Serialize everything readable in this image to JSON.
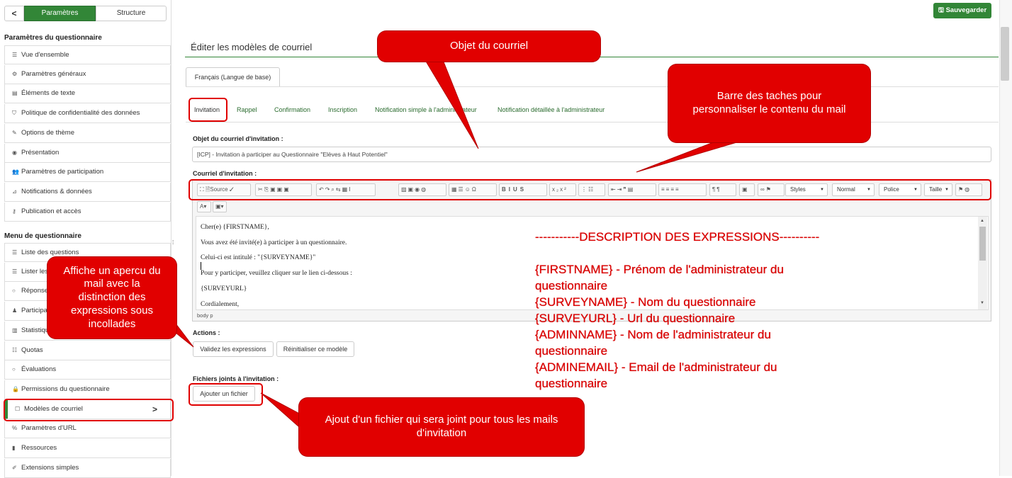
{
  "sidebar": {
    "back_icon": "chevron-left-icon",
    "back_label": "<",
    "tab_params": "Paramètres",
    "tab_structure": "Structure",
    "section1": "Paramètres du questionnaire",
    "section2": "Menu de questionnaire",
    "items1": [
      {
        "icon": "list-icon",
        "glyph": "☰",
        "label": "Vue d'ensemble"
      },
      {
        "icon": "gears-icon",
        "glyph": "⚙",
        "label": "Paramètres généraux"
      },
      {
        "icon": "file-text-icon",
        "glyph": "▤",
        "label": "Éléments de texte"
      },
      {
        "icon": "shield-icon",
        "glyph": "⛉",
        "label": "Politique de confidentialité des données"
      },
      {
        "icon": "brush-icon",
        "glyph": "✎",
        "label": "Options de thème"
      },
      {
        "icon": "eye-icon",
        "glyph": "◉",
        "label": "Présentation"
      },
      {
        "icon": "users-icon",
        "glyph": "👥",
        "label": "Paramètres de participation"
      },
      {
        "icon": "rss-icon",
        "glyph": "⊿",
        "label": "Notifications & données"
      },
      {
        "icon": "key-icon",
        "glyph": "⚷",
        "label": "Publication et accès"
      }
    ],
    "items2": [
      {
        "icon": "list-icon",
        "glyph": "☰",
        "label": "Liste des questions"
      },
      {
        "icon": "list-icon",
        "glyph": "☰",
        "label": "Lister les groupes de questions"
      },
      {
        "icon": "comment-icon",
        "glyph": "○",
        "label": "Réponses"
      },
      {
        "icon": "user-icon",
        "glyph": "♟",
        "label": "Participants"
      },
      {
        "icon": "bar-chart-icon",
        "glyph": "▥",
        "label": "Statistiques"
      },
      {
        "icon": "tasks-icon",
        "glyph": "☷",
        "label": "Quotas"
      },
      {
        "icon": "comment-icon",
        "glyph": "○",
        "label": "Évaluations"
      },
      {
        "icon": "lock-icon",
        "glyph": "🔒",
        "label": "Permissions du questionnaire"
      },
      {
        "icon": "envelope-icon",
        "glyph": "☐",
        "label": "Modèles de courriel"
      },
      {
        "icon": "link-icon",
        "glyph": "%",
        "label": "Paramètres d'URL"
      },
      {
        "icon": "file-icon",
        "glyph": "▮",
        "label": "Ressources"
      },
      {
        "icon": "plug-icon",
        "glyph": "✐",
        "label": "Extensions simples"
      }
    ],
    "active_chevron": ">"
  },
  "header": {
    "save_icon": "save-icon",
    "save_label": "Sauvegarder",
    "page_title": "Éditer les modèles de courriel",
    "language_tab": "Français (Langue de base)"
  },
  "mail_tabs": [
    "Invitation",
    "Rappel",
    "Confirmation",
    "Inscription",
    "Notification simple à l'administrateur",
    "Notification détaillée à l'administrateur"
  ],
  "form": {
    "subject_label": "Objet du courriel d'invitation :",
    "subject_value": "[ICP] - Invitation à participer au Questionnaire \"Elèves à Haut Potentiel\"",
    "body_label": "Courriel d'invitation :",
    "toolbar": {
      "source_label": "Source",
      "styles": "Styles",
      "format": "Normal",
      "font": "Police",
      "size": "Taille"
    },
    "editor_lines": [
      "Cher(e) {FIRSTNAME},",
      "Vous avez été invité(e) à participer à un questionnaire.",
      "Celui-ci est intitulé : \"{SURVEYNAME}\"",
      "Pour y participer, veuillez cliquer sur le lien ci-dessous :",
      "{SURVEYURL}",
      "Cordialement,"
    ],
    "status_body": "body",
    "status_p": "p",
    "actions_label": "Actions :",
    "validate_btn": "Validez les expressions",
    "reset_btn": "Réinitialiser ce modèle",
    "attachments_label": "Fichiers joints à l'invitation :",
    "add_file_btn": "Ajouter un fichier"
  },
  "annotations": {
    "subject_callout": "Objet du courriel",
    "toolbar_callout": "Barre des taches pour personnaliser le contenu du mail",
    "preview_callout": "Affiche un apercu du mail avec la distinction des expressions sous incollades",
    "attach_callout": "Ajout d'un fichier qui sera joint pour tous les mails d'invitation",
    "desc_lines": [
      "-----------DESCRIPTION DES EXPRESSIONS----------",
      "",
      "{FIRSTNAME} - Prénom de l'administrateur du",
      "questionnaire",
      "{SURVEYNAME} - Nom du questionnaire",
      "{SURVEYURL} - Url du questionnaire",
      "{ADMINNAME} - Nom de l'administrateur du",
      "questionnaire",
      "{ADMINEMAIL} - Email de l'administrateur du",
      "questionnaire"
    ],
    "accent": "#e10000"
  },
  "colors": {
    "brand": "#328637",
    "annotation": "#e10000"
  }
}
